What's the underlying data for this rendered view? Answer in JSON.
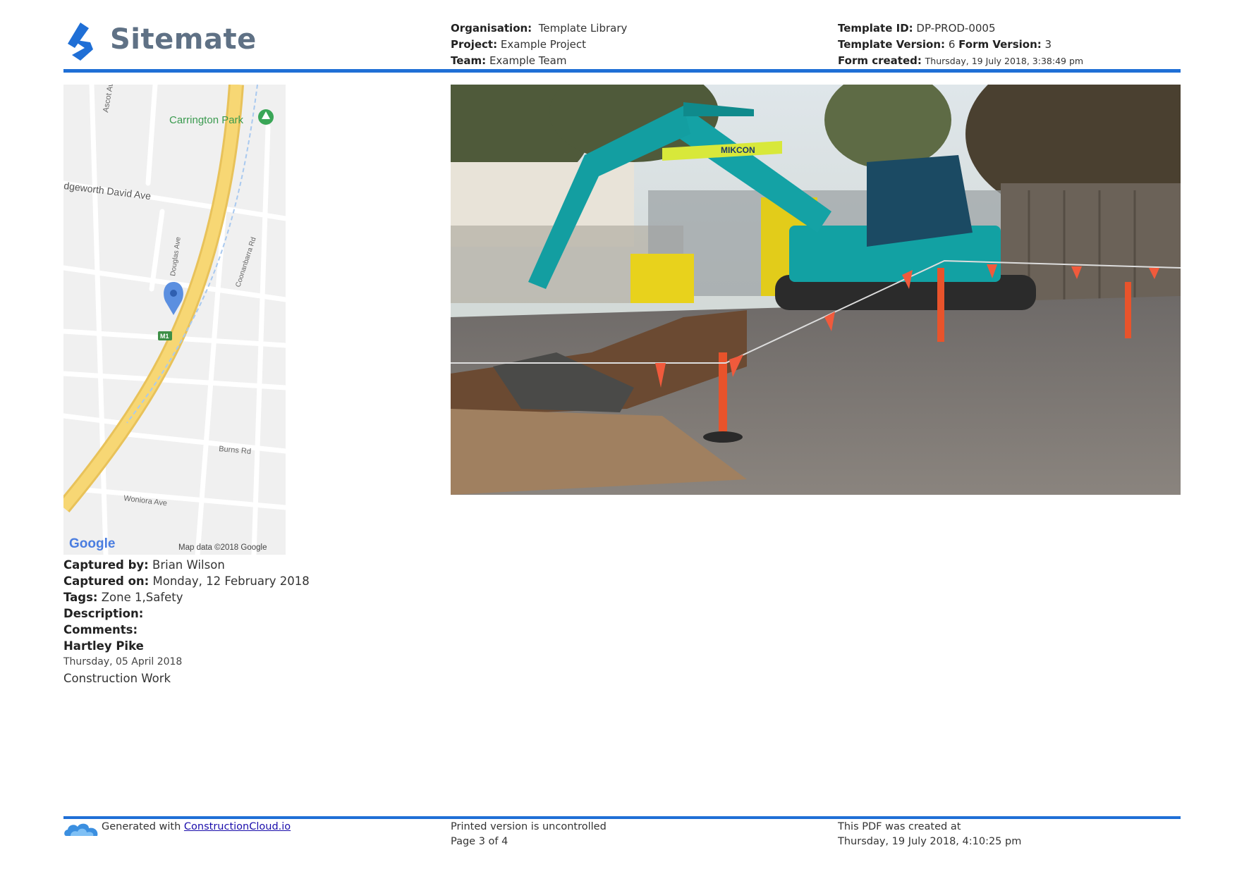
{
  "brand": {
    "name": "Sitemate",
    "color": "#1f6fd6",
    "logo_icon": "sitemate-logo-icon"
  },
  "header": {
    "organisation_label": "Organisation:",
    "organisation_value": "Template Library",
    "project_label": "Project:",
    "project_value": "Example Project",
    "team_label": "Team:",
    "team_value": "Example Team",
    "template_id_label": "Template ID:",
    "template_id_value": "DP-PROD-0005",
    "template_version_label": "Template Version:",
    "template_version_value": "6",
    "form_version_label": "Form Version:",
    "form_version_value": "3",
    "form_created_label": "Form created:",
    "form_created_value": "Thursday, 19 July 2018, 3:38:49 pm"
  },
  "map": {
    "labels": {
      "ascot": "Ascot Ave",
      "park": "Carrington Park",
      "edgeworth": "dgeworth David Ave",
      "douglas": "Douglas Ave",
      "coonanbarra": "Coonanbarra Rd",
      "m1": "M1",
      "burns": "Burns Rd",
      "woniora": "Woniora Ave",
      "google": "Google",
      "attribution": "Map data ©2018 Google"
    }
  },
  "photo": {
    "subject": "excavator-on-construction-site",
    "signage": "MIKCON"
  },
  "details": {
    "captured_by_label": "Captured by:",
    "captured_by_value": "Brian Wilson",
    "captured_on_label": "Captured on:",
    "captured_on_value": "Monday, 12 February 2018",
    "tags_label": "Tags:",
    "tags_value": "Zone 1,Safety",
    "description_label": "Description:",
    "comments_label": "Comments:",
    "signer_name": "Hartley Pike",
    "signer_date": "Thursday, 05 April 2018",
    "signer_role": "Construction Work"
  },
  "footer": {
    "generated_text": "Generated with",
    "generated_link": "ConstructionCloud.io",
    "uncontrolled": "Printed version is uncontrolled",
    "page": "Page 3 of 4",
    "pdf_created_label": "This PDF was created at",
    "pdf_created_value": "Thursday, 19 July 2018, 4:10:25 pm"
  }
}
